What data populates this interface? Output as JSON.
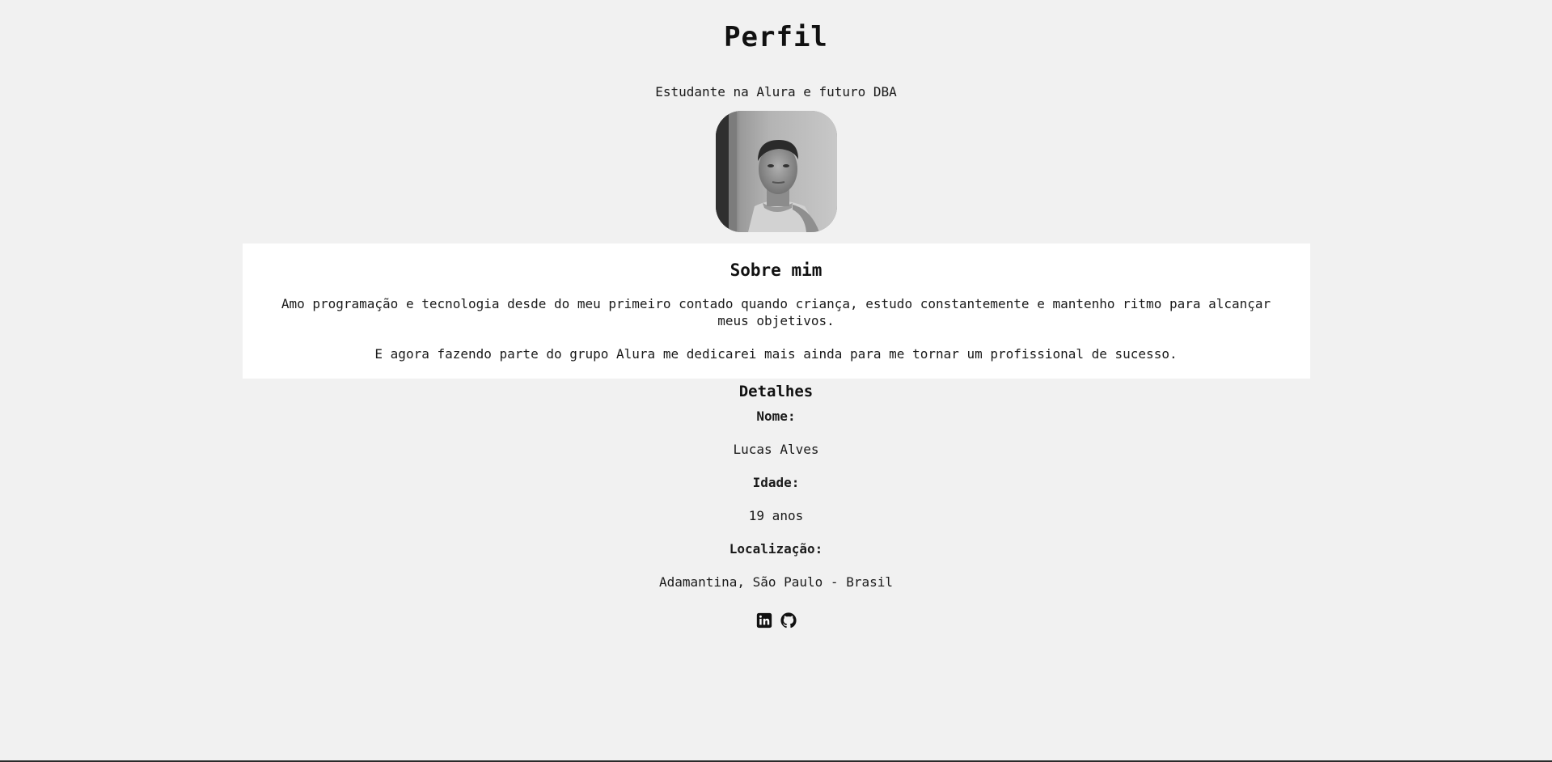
{
  "header": {
    "title": "Perfil",
    "subtitle": "Estudante na Alura e futuro DBA"
  },
  "profile_photo": {
    "alt": "Foto de perfil"
  },
  "about": {
    "heading": "Sobre mim",
    "paragraph_1": "Amo programação e tecnologia desde do meu primeiro contado quando criança, estudo constantemente e mantenho ritmo para alcançar meus objetivos.",
    "paragraph_2": "E agora fazendo parte do grupo Alura me dedicarei mais ainda para me tornar um profissional de sucesso."
  },
  "details": {
    "heading": "Detalhes",
    "name_label": "Nome:",
    "name_value": "Lucas Alves",
    "age_label": "Idade:",
    "age_value": "19 anos",
    "location_label": "Localização:",
    "location_value": "Adamantina, São Paulo - Brasil"
  },
  "social": {
    "icons": [
      "linkedin-icon",
      "github-icon"
    ]
  },
  "colors": {
    "background": "#f1f1f1",
    "card": "#ffffff",
    "text": "#1a1a1a"
  }
}
